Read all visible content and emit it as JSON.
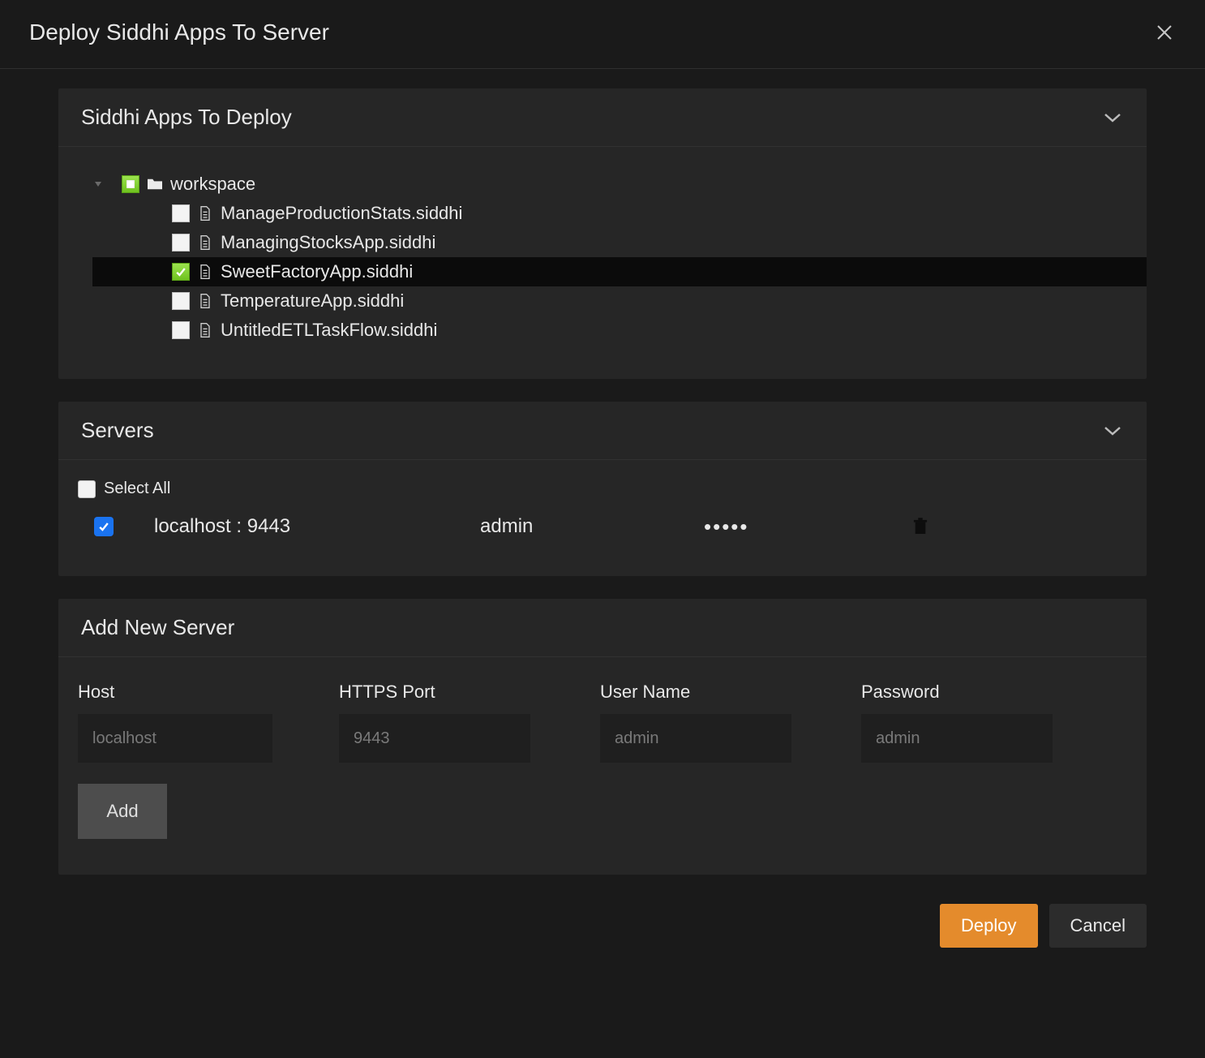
{
  "dialog": {
    "title": "Deploy Siddhi Apps To Server"
  },
  "panels": {
    "apps": {
      "title": "Siddhi Apps To Deploy"
    },
    "servers": {
      "title": "Servers",
      "select_all_label": "Select All"
    },
    "add": {
      "title": "Add New Server",
      "host_label": "Host",
      "port_label": "HTTPS Port",
      "user_label": "User Name",
      "pass_label": "Password",
      "host_placeholder": "localhost",
      "port_placeholder": "9443",
      "user_placeholder": "admin",
      "pass_placeholder": "admin",
      "add_button": "Add"
    }
  },
  "tree": {
    "root": {
      "label": "workspace"
    },
    "items": [
      {
        "label": "ManageProductionStats.siddhi",
        "checked": false,
        "selected": false
      },
      {
        "label": "ManagingStocksApp.siddhi",
        "checked": false,
        "selected": false
      },
      {
        "label": "SweetFactoryApp.siddhi",
        "checked": true,
        "selected": true
      },
      {
        "label": "TemperatureApp.siddhi",
        "checked": false,
        "selected": false
      },
      {
        "label": "UntitledETLTaskFlow.siddhi",
        "checked": false,
        "selected": false
      }
    ]
  },
  "servers": {
    "rows": [
      {
        "host": "localhost : 9443",
        "user": "admin",
        "pass_mask": "•••••",
        "checked": true
      }
    ]
  },
  "footer": {
    "deploy": "Deploy",
    "cancel": "Cancel"
  }
}
